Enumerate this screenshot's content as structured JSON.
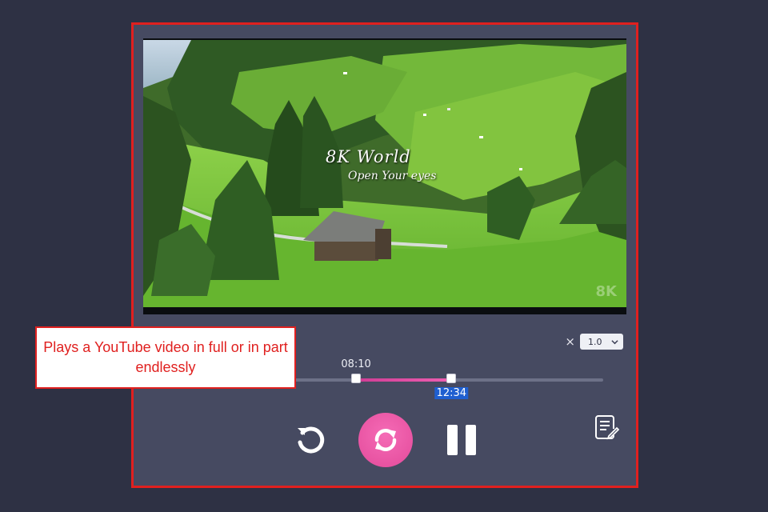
{
  "video": {
    "caption_title": "8K World",
    "caption_subtitle": "Open Your eyes",
    "watermark": "8K"
  },
  "playback": {
    "speed_prefix": "×",
    "speed_value": "1.0",
    "loop_start": "08:10",
    "loop_end": "12:34",
    "loop_start_fraction": 0.43,
    "loop_end_fraction": 0.65
  },
  "callout": {
    "text": "Plays a YouTube video in full or in part endlessly"
  },
  "icons": {
    "replay": "replay-icon",
    "loop": "loop-icon",
    "pause": "pause-icon",
    "notes": "notes-icon",
    "dropdown": "chevron-down-icon"
  },
  "colors": {
    "accent": "#e34a9a",
    "highlight": "#e0201f",
    "panel": "#464a61",
    "background": "#2e3144"
  }
}
